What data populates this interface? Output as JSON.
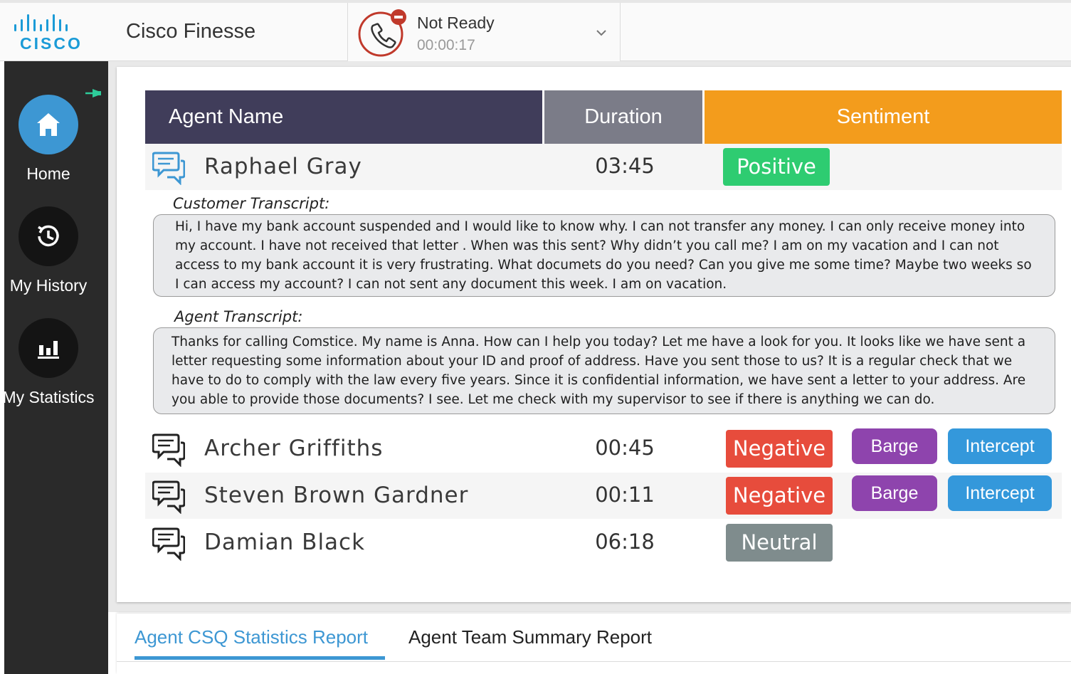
{
  "header": {
    "logo_text": "CISCO",
    "app_title": "Cisco Finesse",
    "status": {
      "label": "Not Ready",
      "timer": "00:00:17"
    }
  },
  "sidebar": {
    "items": [
      {
        "label": "Home",
        "icon": "home-icon",
        "active": true
      },
      {
        "label": "My History",
        "icon": "history-icon",
        "active": false
      },
      {
        "label": "My Statistics",
        "icon": "statistics-icon",
        "active": false
      }
    ]
  },
  "table": {
    "columns": {
      "name": "Agent Name",
      "duration": "Duration",
      "sentiment": "Sentiment"
    },
    "rows": [
      {
        "name": "Raphael Gray",
        "duration": "03:45",
        "sentiment": "Positive",
        "expanded": true
      },
      {
        "name": "Archer Griffiths",
        "duration": "00:45",
        "sentiment": "Negative",
        "barge": "Barge",
        "intercept": "Intercept"
      },
      {
        "name": "Steven Brown Gardner",
        "duration": "00:11",
        "sentiment": "Negative",
        "barge": "Barge",
        "intercept": "Intercept"
      },
      {
        "name": "Damian Black",
        "duration": "06:18",
        "sentiment": "Neutral"
      }
    ]
  },
  "transcripts": {
    "customer_label": "Customer Transcript:",
    "customer_text": "Hi, I have my bank account suspended and I would like to know why. I can not transfer any money. I can only receive money into my account. I have not received that letter . When was this sent? Why didn’t you call me? I am on my vacation and I can not access to my bank account it is very frustrating. What documets do you need? Can you give me some time? Maybe two weeks so I can access my account? I can not sent any document this week. I am on vacation.",
    "agent_label": "Agent Transcript:",
    "agent_text": "Thanks for calling Comstice. My name is Anna. How can I help you today? Let me have a look for you. It looks like we have sent a letter requesting some information about your ID and proof of address. Have you sent those to us? It is a regular check that we have to do to comply with the law every five years. Since it is confidential information, we have sent a letter to your address. Are you able to provide those documents? I see. Let me check with my supervisor to see if there is anything we can do."
  },
  "reports": {
    "tabs": [
      {
        "label": "Agent CSQ Statistics Report",
        "active": true
      },
      {
        "label": "Agent Team Summary Report",
        "active": false
      }
    ]
  },
  "colors": {
    "brand_blue": "#1b9bd7",
    "header_dark": "#403d5a",
    "header_gray": "#7b7c88",
    "header_orange": "#f39c1c",
    "positive": "#2ecc71",
    "negative": "#e74c3c",
    "neutral": "#7f8c8d",
    "barge": "#8e44ad",
    "intercept": "#3498db",
    "not_ready_red": "#c0392b"
  }
}
